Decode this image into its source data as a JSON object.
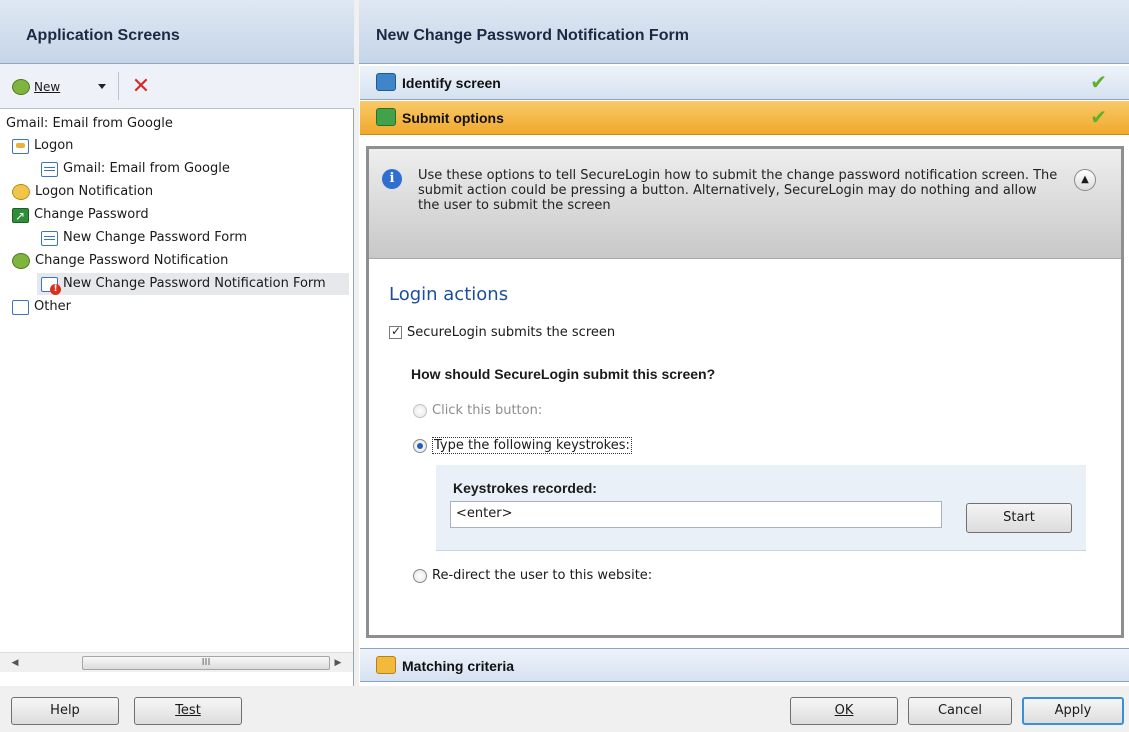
{
  "left_pane": {
    "title": "Application Screens",
    "toolbar": {
      "new_label": "New",
      "new_icon": "new-icon",
      "delete_icon": "delete-x-icon"
    },
    "tree": [
      {
        "label": "Gmail: Email from Google",
        "icon": "none"
      },
      {
        "label": "Logon",
        "icon": "logon-icon"
      },
      {
        "label": "Gmail: Email from Google",
        "icon": "form-icon"
      },
      {
        "label": "Logon Notification",
        "icon": "notification-bubble-icon"
      },
      {
        "label": "Change Password",
        "icon": "change-password-icon"
      },
      {
        "label": "New Change Password Form",
        "icon": "form-icon"
      },
      {
        "label": "Change Password Notification",
        "icon": "notification-bubble-icon"
      },
      {
        "label": "New Change Password Notification Form",
        "icon": "form-alert-icon",
        "selected": true
      },
      {
        "label": "Other",
        "icon": "other-icon"
      }
    ],
    "scrollbar": {
      "thumb_glyph": "III",
      "left_arrow": "◀",
      "right_arrow": "▶"
    }
  },
  "right_pane": {
    "title": "New Change Password Notification Form",
    "sections": {
      "identify": {
        "label": "Identify screen",
        "icon": "identify-icon",
        "complete_icon": "check-icon"
      },
      "submit": {
        "label": "Submit options",
        "icon": "submit-icon",
        "complete_icon": "check-icon"
      },
      "matching": {
        "label": "Matching criteria",
        "icon": "matching-icon"
      }
    },
    "info": {
      "icon": "info-icon",
      "text": "Use these options to tell SecureLogin how to submit the change password notification screen. The submit action could be pressing a button. Alternatively, SecureLogin may do nothing and allow the user to submit the screen",
      "collapse_icon": "chevron-up-icon"
    },
    "login_actions": {
      "heading": "Login actions",
      "submits_checkbox_label": "SecureLogin submits the screen",
      "submits_checked": true,
      "question": "How should SecureLogin submit this screen?",
      "options": {
        "click_button": "Click this button:",
        "type_keystrokes": "Type the following keystrokes:",
        "redirect": "Re-direct the user to this website:"
      },
      "selected_option": "type_keystrokes",
      "keystrokes_label": "Keystrokes recorded:",
      "keystrokes_value": "<enter>",
      "start_button": "Start"
    }
  },
  "bottom_bar": {
    "help": "Help",
    "test": "Test",
    "ok": "OK",
    "cancel": "Cancel",
    "apply": "Apply"
  },
  "colors": {
    "header_blue": "#c5d5e8",
    "submit_orange": "#f0a92c",
    "accent_title": "#1c4f9b",
    "check_green": "#5fb02d",
    "delete_red": "#d52b2b"
  }
}
